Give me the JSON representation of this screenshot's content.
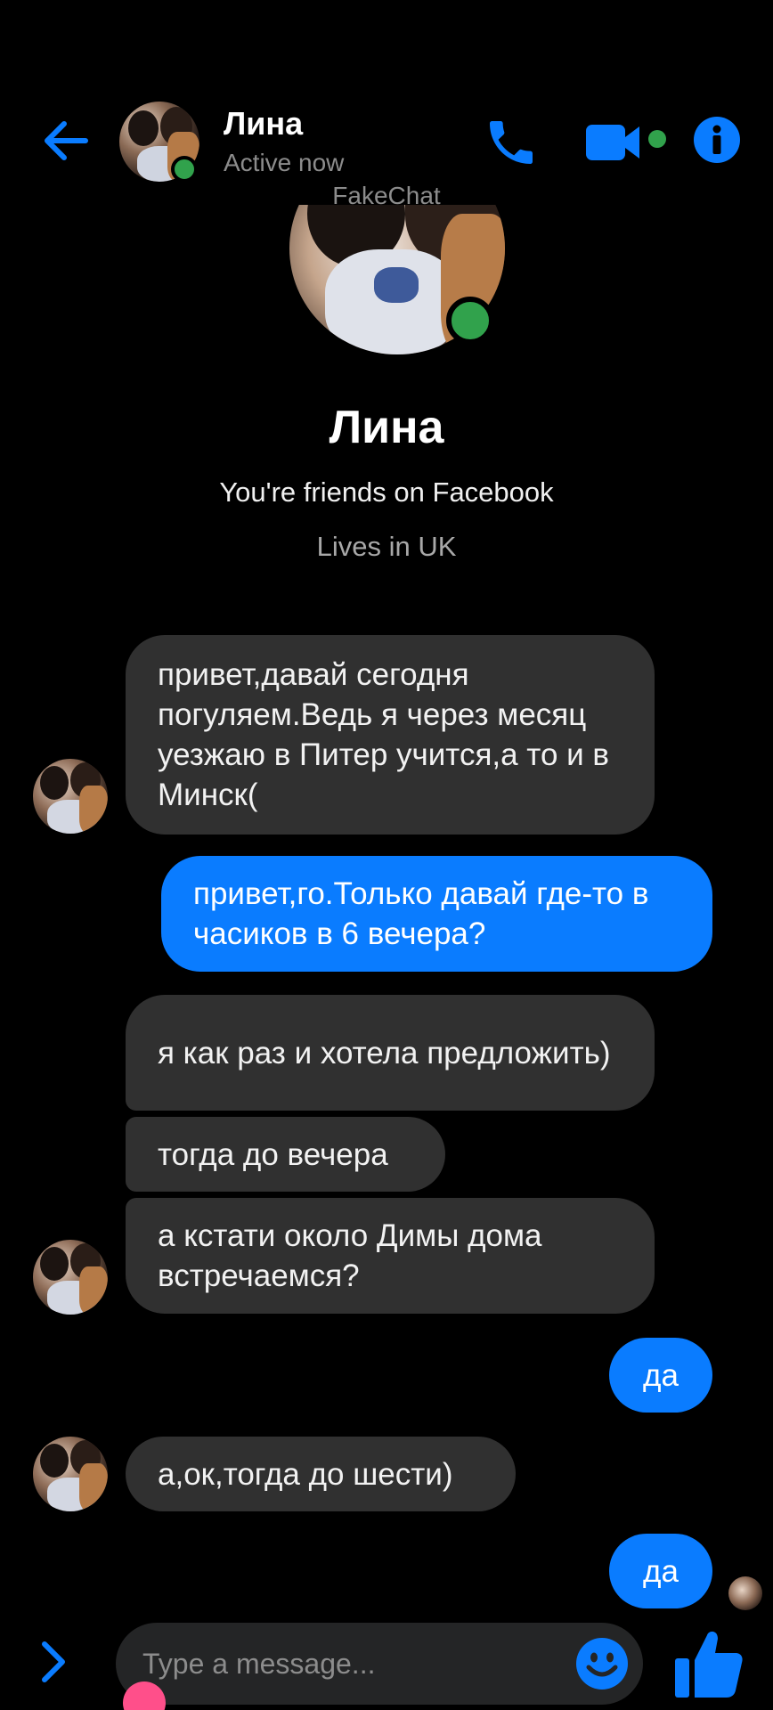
{
  "header": {
    "contact_name": "Лина",
    "status": "Active now",
    "watermark": "FakeChat",
    "icons": [
      "back-arrow-icon",
      "phone-icon",
      "video-camera-icon",
      "info-icon"
    ],
    "accent_color": "#0a7cff",
    "online_color": "#31a24c"
  },
  "profile": {
    "name": "Лина",
    "friends_text": "You're friends on Facebook",
    "lives_text": "Lives in UK"
  },
  "messages": [
    {
      "direction": "in",
      "text": "привет,давай сегодня погуляем.Ведь я через месяц уезжаю в Питер учится,а то и в Минск("
    },
    {
      "direction": "out",
      "text": "привет,го.Только давай где-то в часиков в 6 вечера?"
    },
    {
      "direction": "in",
      "text": "я как раз и хотела предложить)"
    },
    {
      "direction": "in",
      "text": "тогда до вечера"
    },
    {
      "direction": "in",
      "text": "а кстати около Димы дома встречаемся?"
    },
    {
      "direction": "out",
      "text": "да"
    },
    {
      "direction": "in",
      "text": "а,ок,тогда до шести)"
    },
    {
      "direction": "out",
      "text": "да"
    }
  ],
  "composer": {
    "placeholder": "Type a message...",
    "icons": [
      "chevron-right-icon",
      "emoji-icon",
      "thumbs-up-icon"
    ]
  },
  "colors": {
    "incoming_bubble": "#303030",
    "outgoing_bubble": "#0a7cff",
    "background": "#000000"
  }
}
